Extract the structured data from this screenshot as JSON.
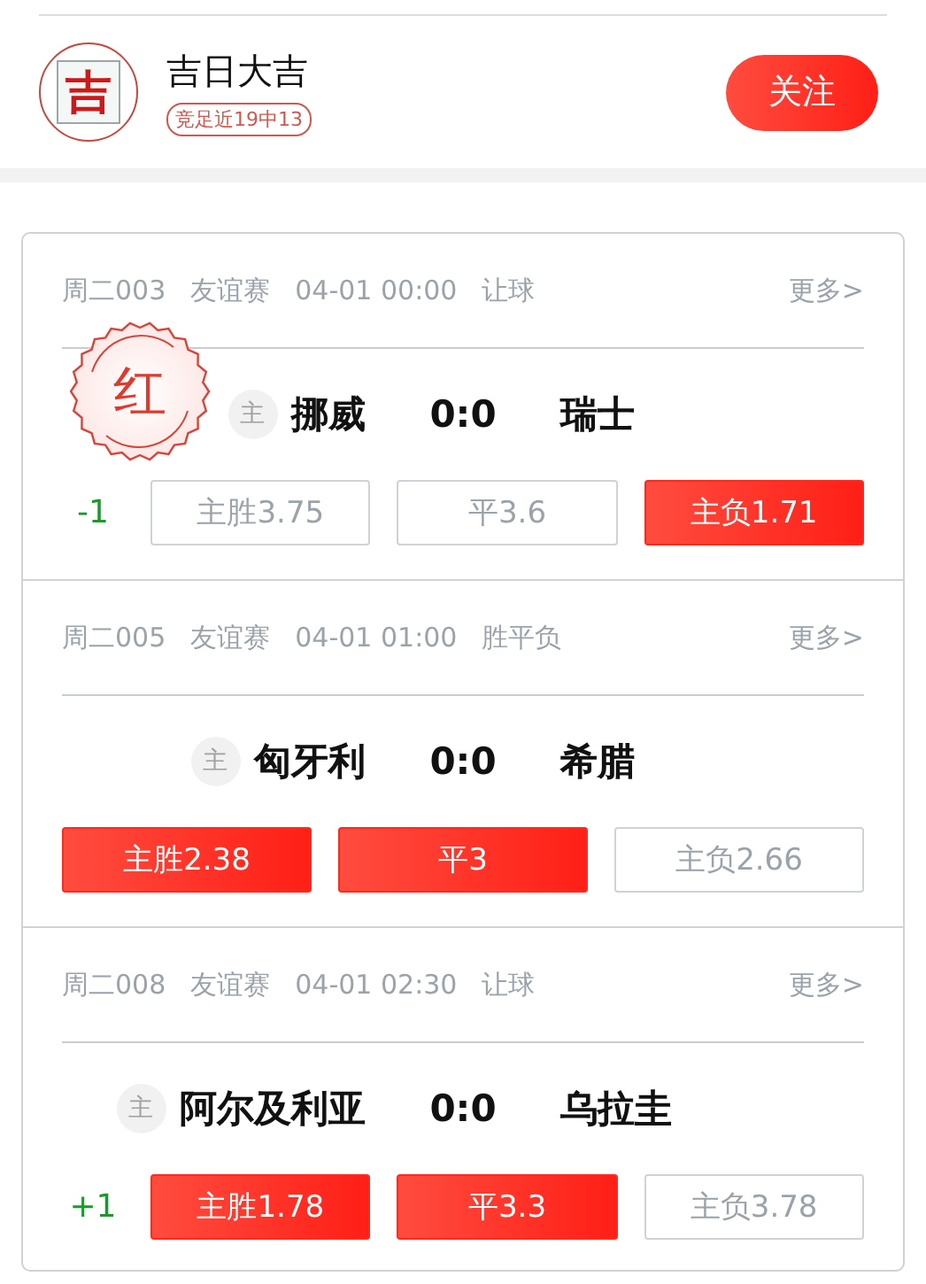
{
  "expert": {
    "avatar_char": "吉",
    "name": "吉日大吉",
    "record": "竞足近19中13",
    "follow_button": "关注"
  },
  "matches": [
    {
      "code": "周二003",
      "league": "友谊赛",
      "time": "04-01 00:00",
      "play": "让球",
      "more": "更多>",
      "stamp": "红",
      "home_tag": "主",
      "home": "挪威",
      "score": "0:0",
      "away": "瑞士",
      "handicap": "-1",
      "odds": [
        {
          "label": "主胜3.75",
          "selected": false
        },
        {
          "label": "平3.6",
          "selected": false
        },
        {
          "label": "主负1.71",
          "selected": true
        }
      ]
    },
    {
      "code": "周二005",
      "league": "友谊赛",
      "time": "04-01 01:00",
      "play": "胜平负",
      "more": "更多>",
      "home_tag": "主",
      "home": "匈牙利",
      "score": "0:0",
      "away": "希腊",
      "odds": [
        {
          "label": "主胜2.38",
          "selected": true
        },
        {
          "label": "平3",
          "selected": true
        },
        {
          "label": "主负2.66",
          "selected": false
        }
      ]
    },
    {
      "code": "周二008",
      "league": "友谊赛",
      "time": "04-01 02:30",
      "play": "让球",
      "more": "更多>",
      "home_tag": "主",
      "home": "阿尔及利亚",
      "score": "0:0",
      "away": "乌拉圭",
      "handicap": "+1",
      "odds": [
        {
          "label": "主胜1.78",
          "selected": true
        },
        {
          "label": "平3.3",
          "selected": true
        },
        {
          "label": "主负3.78",
          "selected": false
        }
      ]
    }
  ]
}
